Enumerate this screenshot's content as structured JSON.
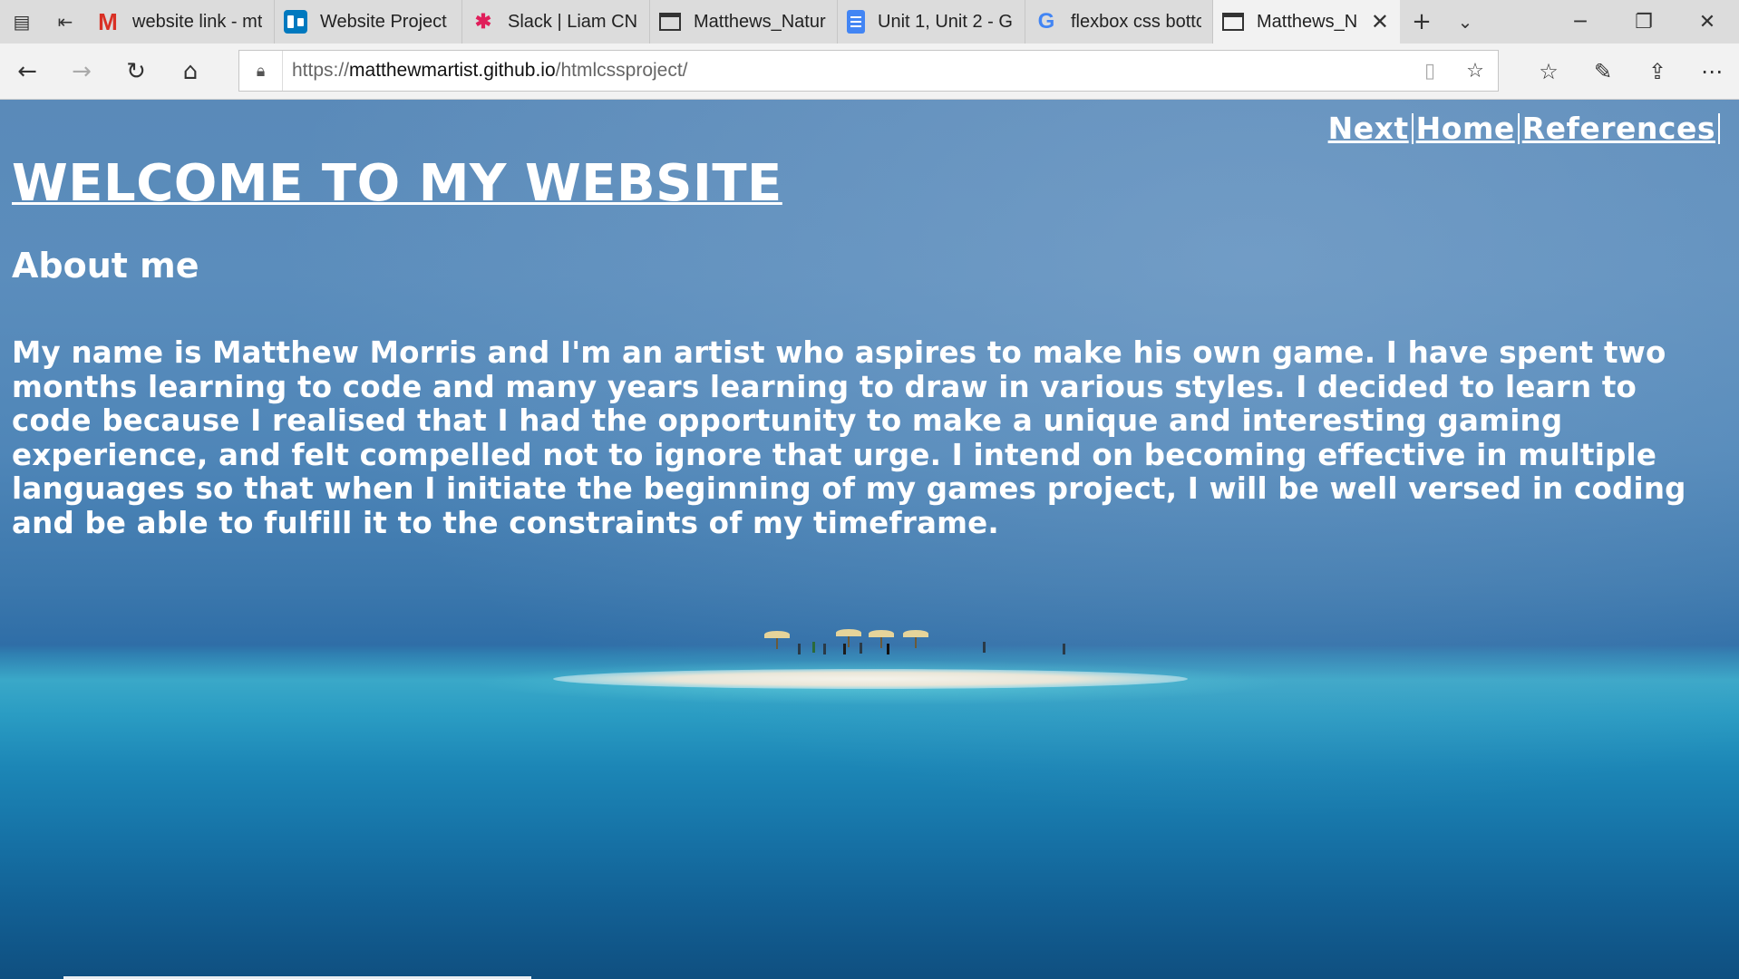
{
  "browser": {
    "tabs": [
      {
        "title": "website link - mt",
        "icon": "gmail-icon"
      },
      {
        "title": "Website Project |",
        "icon": "trello-icon"
      },
      {
        "title": "Slack | Liam CN |",
        "icon": "slack-icon"
      },
      {
        "title": "Matthews_Natur",
        "icon": "window-icon"
      },
      {
        "title": "Unit 1, Unit 2 - G",
        "icon": "docs-icon"
      },
      {
        "title": "flexbox css bottc",
        "icon": "google-icon"
      },
      {
        "title": "Matthews_N",
        "icon": "window-icon",
        "active": true
      }
    ],
    "address": {
      "prefix": "https://",
      "host": "matthewmartist.github.io",
      "path": "/htmlcssproject/"
    }
  },
  "site": {
    "nav": [
      "Next",
      "Home",
      "References"
    ],
    "title": "WELCOME TO MY WEBSITE",
    "about_heading": "About me",
    "bio": "My name is Matthew Morris and I'm an artist who aspires to make his own game. I have spent two months learning to code and many years learning to draw in various styles. I decided to learn to code because I realised that I had the opportunity to make a unique and interesting gaming experience, and felt compelled not to ignore that urge. I intend on becoming effective in multiple languages so that when I initiate the beginning of my games project, I will be well versed in coding and be able to fulfill it to the constraints of my timeframe."
  },
  "colors": {
    "sky": "#5a8ab9",
    "sea": "#1c86b6",
    "text": "#ffffff"
  }
}
